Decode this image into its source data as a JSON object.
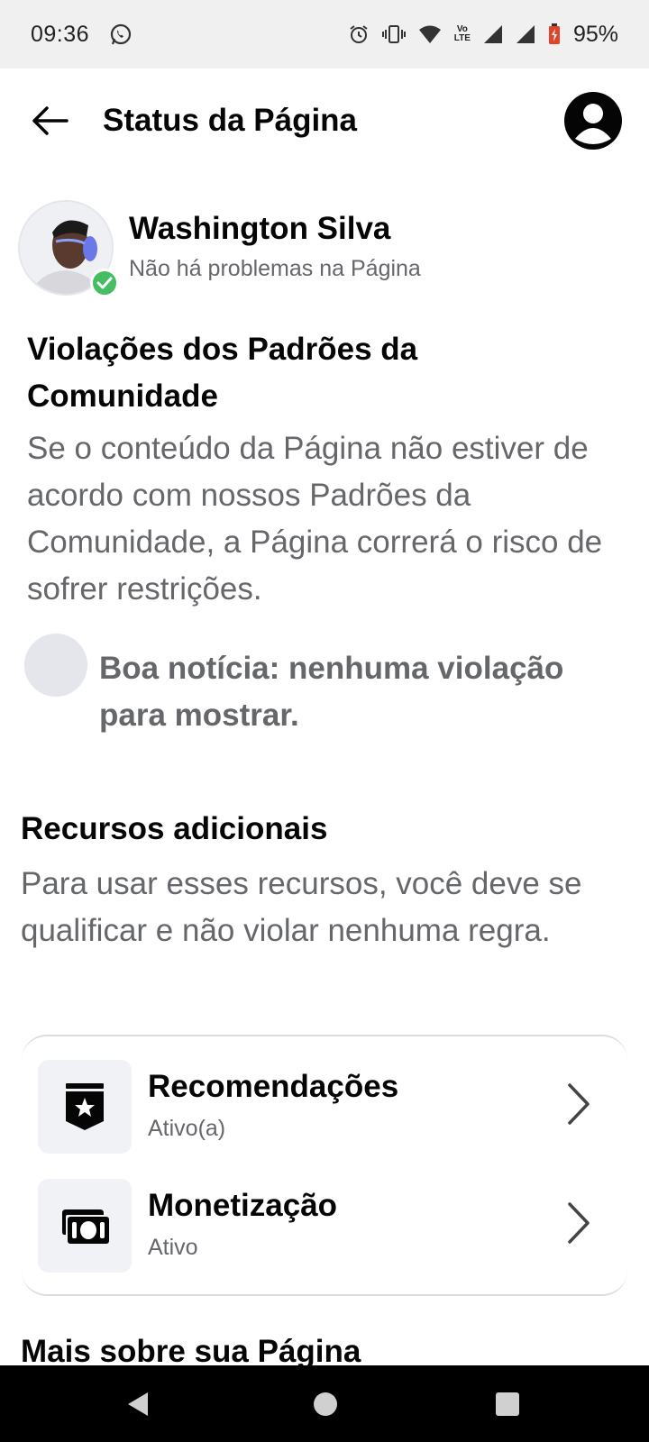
{
  "status_bar": {
    "time": "09:36",
    "battery_percent": "95%",
    "lte_top": "Vo",
    "lte_bottom": "LTE",
    "icons": [
      "whatsapp-icon",
      "alarm-icon",
      "vibrate-icon",
      "wifi-icon",
      "volte-icon",
      "signal-icon",
      "signal-icon",
      "battery-icon"
    ]
  },
  "header": {
    "title": "Status da Página",
    "back_icon": "arrow-left-icon",
    "profile_icon": "user-circle-icon"
  },
  "identity": {
    "name": "Washington Silva",
    "status": "Não há problemas na Página",
    "badge_color": "#45bd62"
  },
  "community_standards": {
    "title": "Violações dos Padrões da Comunidade",
    "description": "Se o conteúdo da Página não estiver de acordo com nossos Padrões da Comunidade, a Página correrá o risco de sofrer restrições.",
    "good_news": "Boa notícia: nenhuma violação para mostrar."
  },
  "additional_resources": {
    "title": "Recursos adicionais",
    "description": "Para usar esses recursos, você deve se qualificar e não violar nenhuma regra.",
    "items": [
      {
        "label": "Recomendações",
        "status": "Ativo(a)",
        "icon": "star-badge-icon"
      },
      {
        "label": "Monetização",
        "status": "Ativo",
        "icon": "money-icon"
      }
    ]
  },
  "more_section": {
    "title": "Mais sobre sua Página"
  },
  "colors": {
    "primary_text": "#050505",
    "secondary_text": "#65676b",
    "icon_bg": "#f0f2f5"
  }
}
